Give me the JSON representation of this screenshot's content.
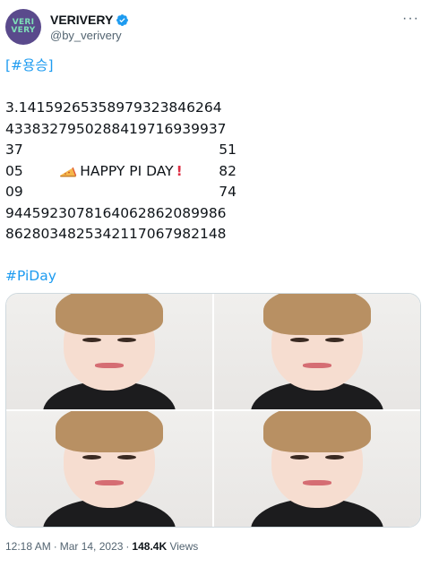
{
  "account": {
    "avatar_text_top": "VERI",
    "avatar_text_bottom": "VERY",
    "display_name": "VERIVERY",
    "handle": "@by_verivery",
    "more_icon": "more-horizontal-icon",
    "verified_icon": "verified-badge-icon"
  },
  "tweet": {
    "hashtag_top": "[#용승]",
    "pi_line1": "3.14159265358979323846264",
    "pi_line2": "4338327950288419716939937",
    "row1_left": "37",
    "row1_right": "51",
    "row2_left": "05",
    "happy_text": "HAPPY PI DAY",
    "row2_right": "82",
    "row3_left": "09",
    "row3_right": "74",
    "pi_line6": "9445923078164062862089986",
    "pi_line7": "8628034825342117067982148",
    "hashtag_bottom": "#PiDay"
  },
  "media": {
    "photos": [
      "photo 1",
      "photo 2",
      "photo 3",
      "photo 4"
    ]
  },
  "meta": {
    "time": "12:18 AM",
    "date": "Mar 14, 2023",
    "views_count": "148.4K",
    "views_label": "Views"
  },
  "colors": {
    "link": "#1d9bf0",
    "text": "#0f1419",
    "muted": "#536471",
    "verified": "#1d9bf0",
    "exclamation": "#dd2e44"
  }
}
